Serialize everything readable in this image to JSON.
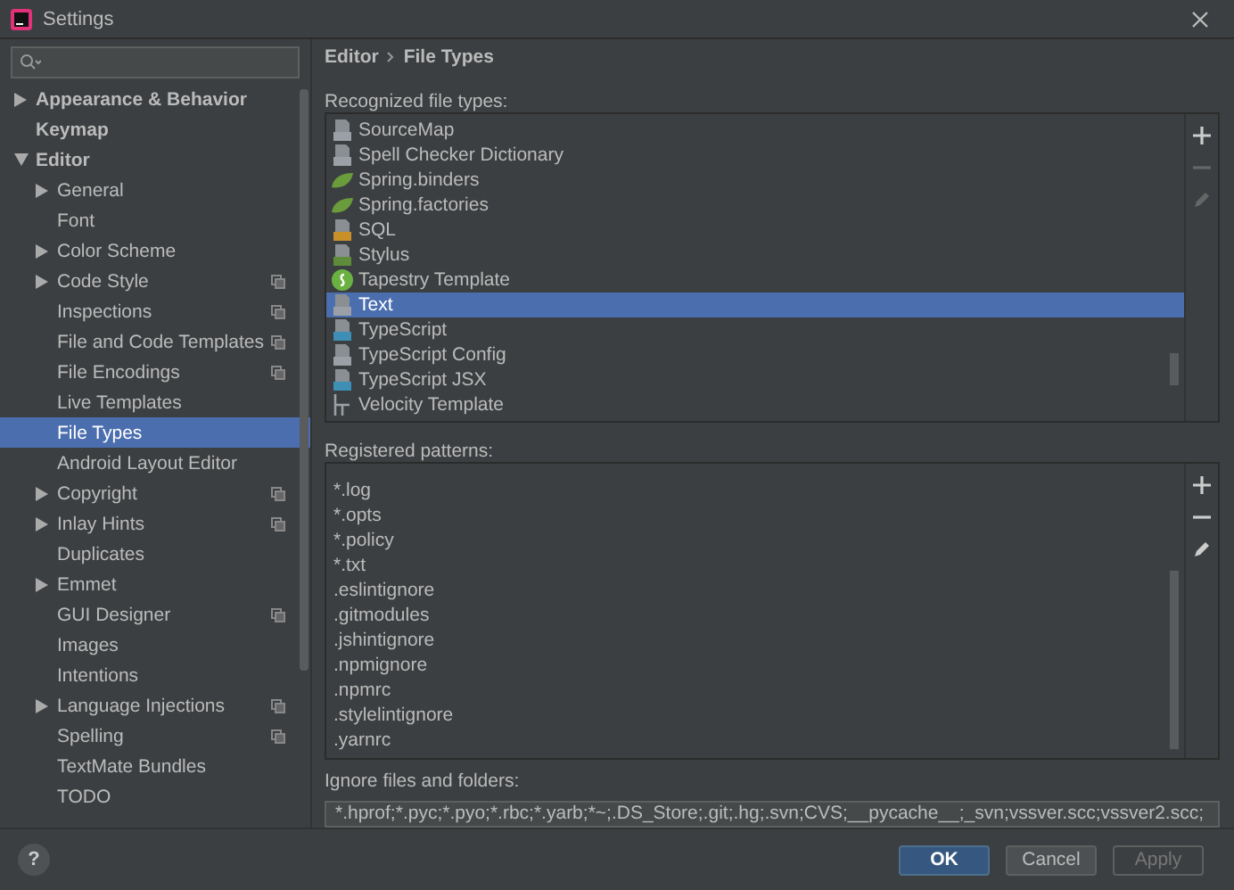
{
  "window": {
    "title": "Settings"
  },
  "sidebar": {
    "items": [
      {
        "label": "Appearance & Behavior",
        "expanded": false,
        "selected": false,
        "project_scope": false
      },
      {
        "label": "Keymap",
        "selected": false,
        "project_scope": false
      },
      {
        "label": "Editor",
        "expanded": true,
        "selected": false,
        "project_scope": false,
        "children": [
          {
            "label": "General",
            "expanded": false,
            "selected": false,
            "project_scope": false
          },
          {
            "label": "Font",
            "selected": false,
            "project_scope": false
          },
          {
            "label": "Color Scheme",
            "expanded": false,
            "selected": false,
            "project_scope": false
          },
          {
            "label": "Code Style",
            "expanded": false,
            "selected": false,
            "project_scope": true
          },
          {
            "label": "Inspections",
            "selected": false,
            "project_scope": true
          },
          {
            "label": "File and Code Templates",
            "selected": false,
            "project_scope": true
          },
          {
            "label": "File Encodings",
            "selected": false,
            "project_scope": true
          },
          {
            "label": "Live Templates",
            "selected": false,
            "project_scope": false
          },
          {
            "label": "File Types",
            "selected": true,
            "project_scope": false
          },
          {
            "label": "Android Layout Editor",
            "selected": false,
            "project_scope": false
          },
          {
            "label": "Copyright",
            "expanded": false,
            "selected": false,
            "project_scope": true
          },
          {
            "label": "Inlay Hints",
            "expanded": false,
            "selected": false,
            "project_scope": true
          },
          {
            "label": "Duplicates",
            "selected": false,
            "project_scope": false
          },
          {
            "label": "Emmet",
            "expanded": false,
            "selected": false,
            "project_scope": false
          },
          {
            "label": "GUI Designer",
            "selected": false,
            "project_scope": true
          },
          {
            "label": "Images",
            "selected": false,
            "project_scope": false
          },
          {
            "label": "Intentions",
            "selected": false,
            "project_scope": false
          },
          {
            "label": "Language Injections",
            "expanded": false,
            "selected": false,
            "project_scope": true
          },
          {
            "label": "Spelling",
            "selected": false,
            "project_scope": true
          },
          {
            "label": "TextMate Bundles",
            "selected": false,
            "project_scope": false
          },
          {
            "label": "TODO",
            "selected": false,
            "project_scope": false
          }
        ]
      }
    ]
  },
  "breadcrumb": [
    "Editor",
    "File Types"
  ],
  "recognized": {
    "label": "Recognized file types:",
    "items": [
      {
        "name": "SourceMap",
        "kind": "file",
        "color": "#9aa0a6",
        "selected": false
      },
      {
        "name": "Spell Checker Dictionary",
        "kind": "file",
        "color": "#9aa0a6",
        "selected": false
      },
      {
        "name": "Spring.binders",
        "kind": "spring",
        "color": "#6a9c3c",
        "selected": false
      },
      {
        "name": "Spring.factories",
        "kind": "spring",
        "color": "#6a9c3c",
        "selected": false
      },
      {
        "name": "SQL",
        "kind": "file",
        "color": "#c9902a",
        "selected": false
      },
      {
        "name": "Stylus",
        "kind": "file",
        "color": "#5f8c3a",
        "selected": false
      },
      {
        "name": "Tapestry Template",
        "kind": "tapestry",
        "color": "#6bb142",
        "selected": false
      },
      {
        "name": "Text",
        "kind": "file",
        "color": "#9aa0a6",
        "selected": true
      },
      {
        "name": "TypeScript",
        "kind": "file",
        "color": "#3d8fb5",
        "selected": false
      },
      {
        "name": "TypeScript Config",
        "kind": "file",
        "color": "#9aa0a6",
        "selected": false
      },
      {
        "name": "TypeScript JSX",
        "kind": "file",
        "color": "#3d8fb5",
        "selected": false
      },
      {
        "name": "Velocity Template",
        "kind": "velocity",
        "color": "#9aa0a6",
        "selected": false
      }
    ]
  },
  "patterns": {
    "label": "Registered patterns:",
    "items": [
      "*.log",
      "*.opts",
      "*.policy",
      "*.txt",
      ".eslintignore",
      ".gitmodules",
      ".jshintignore",
      ".npmignore",
      ".npmrc",
      ".stylelintignore",
      ".yarnrc"
    ]
  },
  "ignore": {
    "label": "Ignore files and folders:",
    "value": "*.hprof;*.pyc;*.pyo;*.rbc;*.yarb;*~;.DS_Store;.git;.hg;.svn;CVS;__pycache__;_svn;vssver.scc;vssver2.scc;"
  },
  "help": "?",
  "buttons": [
    {
      "label": "OK",
      "kind": "primary",
      "disabled": false
    },
    {
      "label": "Cancel",
      "kind": "normal",
      "disabled": false
    },
    {
      "label": "Apply",
      "kind": "normal",
      "disabled": true
    }
  ]
}
